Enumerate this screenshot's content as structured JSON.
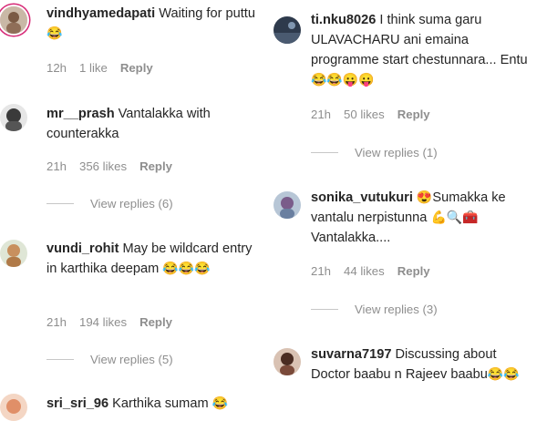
{
  "left": [
    {
      "id": "c1",
      "username": "vindhyamedapati",
      "text": "Waiting for puttu",
      "emoji": "😂",
      "time": "12h",
      "likes": "1 like",
      "reply": "Reply",
      "avatar_color": "#a1887f"
    },
    {
      "id": "c2",
      "username": "mr__prash",
      "text": "Vantalakka with counterakka",
      "time": "21h",
      "likes": "356 likes",
      "reply": "Reply",
      "avatar_color": "#424242",
      "view_replies": "View replies (6)"
    },
    {
      "id": "c3",
      "username": "vundi_rohit",
      "text": "May be wildcard entry in karthika deepam",
      "emoji": "😂😂😂",
      "time": "21h",
      "likes": "194 likes",
      "reply": "Reply",
      "avatar_color": "#d7a86e",
      "view_replies": "View replies (5)"
    },
    {
      "id": "c4",
      "username": "sri_sri_96",
      "text": "Karthika sumam",
      "emoji": "😂",
      "avatar_color": "#e2a37a"
    }
  ],
  "right": [
    {
      "id": "c5",
      "username": "ti.nku8026",
      "text": "I think suma garu ULAVACHARU ani emaina programme start chestunnara... Entu",
      "emoji": "😂😂😛😛",
      "time": "21h",
      "likes": "50 likes",
      "reply": "Reply",
      "avatar_color": "#3b4a5e",
      "view_replies": "View replies (1)"
    },
    {
      "id": "c6",
      "username": "sonika_vutukuri",
      "text": "Sumakka ke vantalu nerpistunna",
      "emoji_start": "😍",
      "emoji": "💪🔍🧰",
      "text_after": "Vantalakka....",
      "time": "21h",
      "likes": "44 likes",
      "reply": "Reply",
      "avatar_color": "#8aa0b8",
      "view_replies": "View replies (3)"
    },
    {
      "id": "c7",
      "username": "suvarna7197",
      "text": "Discussing about Doctor baabu n Rajeev baabu",
      "emoji": "😂😂",
      "avatar_color": "#5b3a2e"
    }
  ]
}
